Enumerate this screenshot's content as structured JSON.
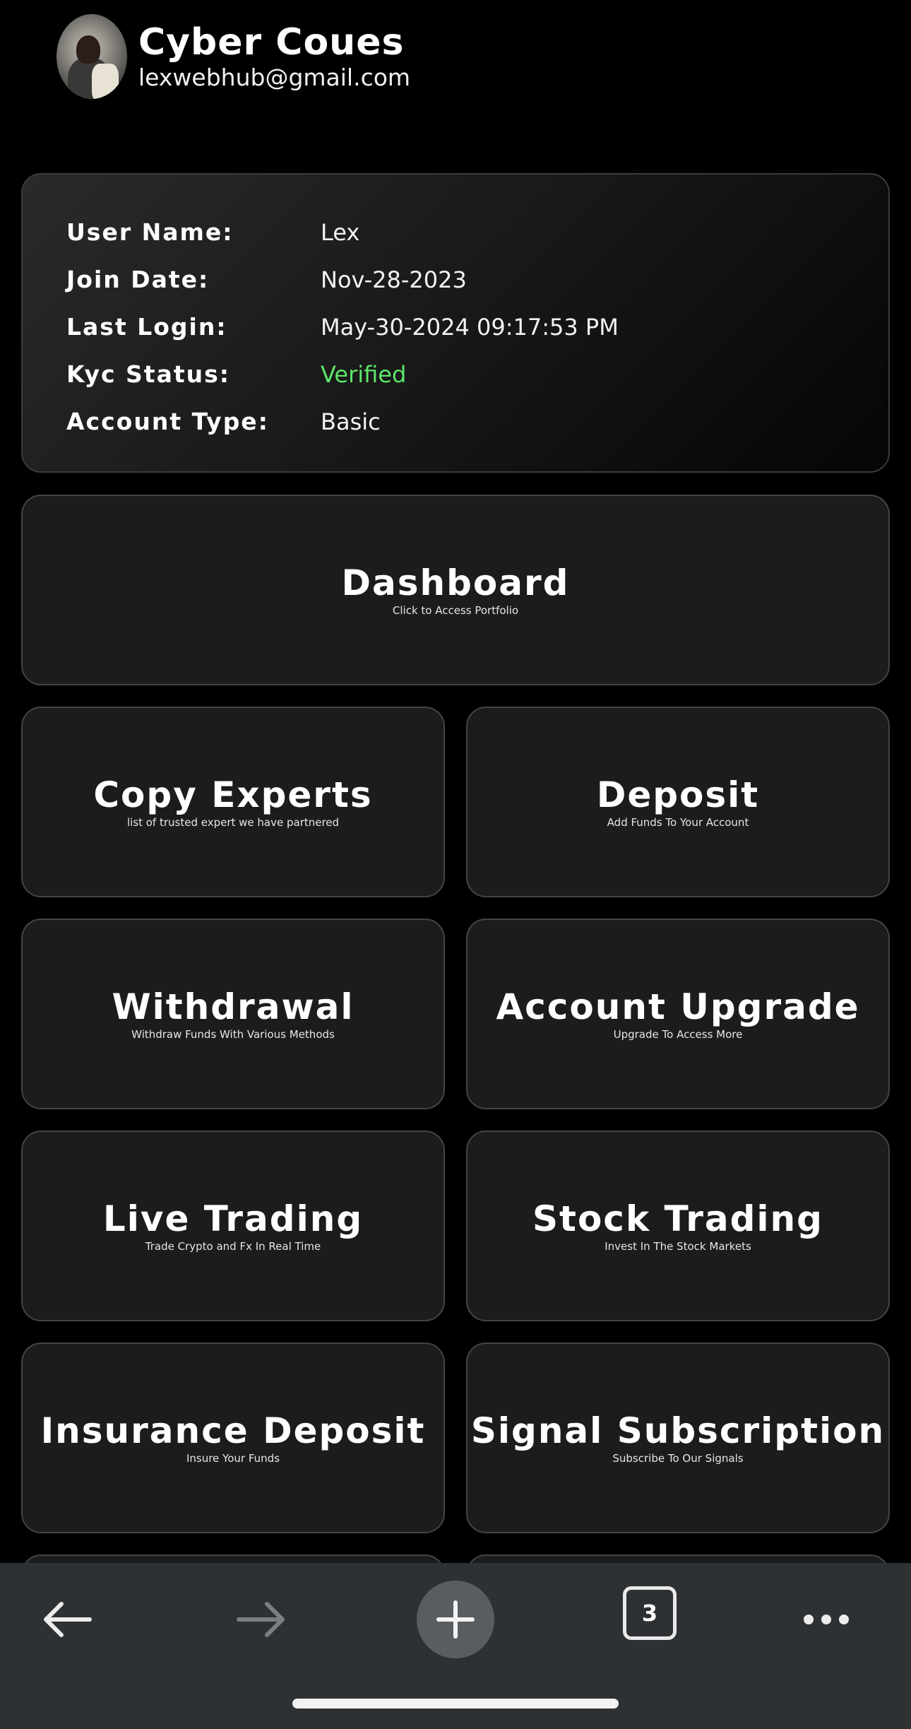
{
  "profile": {
    "name": "Cyber Coues",
    "email": "lexwebhub@gmail.com"
  },
  "info": {
    "user_name_label": "User Name:",
    "user_name": "Lex",
    "join_date_label": "Join Date:",
    "join_date": "Nov-28-2023",
    "last_login_label": "Last Login:",
    "last_login": "May-30-2024 09:17:53 PM",
    "kyc_label": "Kyc Status:",
    "kyc_status": "Verified",
    "account_type_label": "Account Type:",
    "account_type": "Basic"
  },
  "tiles": {
    "dashboard": {
      "title": "Dashboard",
      "subtitle": "Click to Access Portfolio"
    },
    "copy_experts": {
      "title": "Copy Experts",
      "subtitle": "list of trusted expert we have partnered"
    },
    "deposit": {
      "title": "Deposit",
      "subtitle": "Add Funds To Your Account"
    },
    "withdrawal": {
      "title": "Withdrawal",
      "subtitle": "Withdraw Funds With Various Methods"
    },
    "account_upgrade": {
      "title": "Account Upgrade",
      "subtitle": "Upgrade To Access More"
    },
    "live_trading": {
      "title": "Live Trading",
      "subtitle": "Trade Crypto and Fx In Real Time"
    },
    "stock_trading": {
      "title": "Stock Trading",
      "subtitle": "Invest In The Stock Markets"
    },
    "insurance_deposit": {
      "title": "Insurance Deposit",
      "subtitle": "Insure Your Funds"
    },
    "signal_subscription": {
      "title": "Signal Subscription",
      "subtitle": "Subscribe To Our Signals"
    }
  },
  "browser_bar": {
    "tab_count": "3",
    "icons": [
      "back-arrow-icon",
      "forward-arrow-icon",
      "plus-icon",
      "tabs-icon",
      "more-dots-icon"
    ]
  },
  "colors": {
    "background": "#000000",
    "card": "#1c1c1c",
    "verified": "#5ee66a",
    "toolbar": "#2e3134"
  }
}
